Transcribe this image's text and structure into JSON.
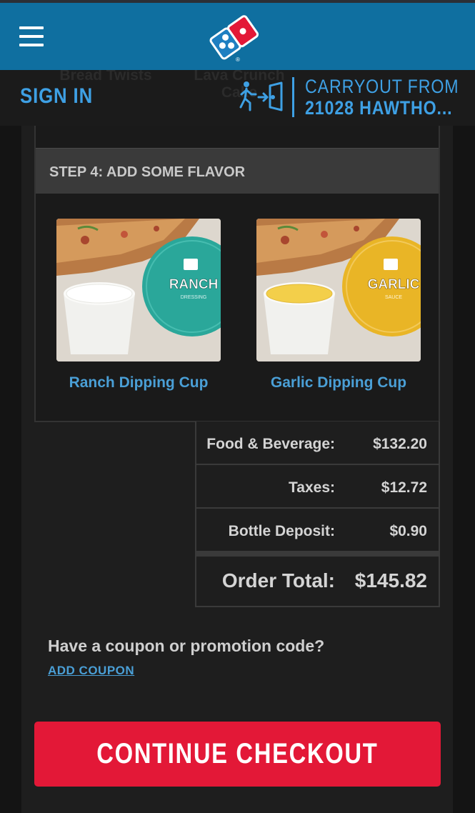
{
  "header": {
    "menu_icon": "hamburger-menu-icon",
    "logo_icon": "dominos-logo-icon",
    "brand_colors": {
      "header_bg": "#0f6fa0",
      "logo_red": "#e31837",
      "logo_blue": "#006491"
    }
  },
  "subbar": {
    "ghost_items": [
      "Bread Twists",
      "Lava Crunch Cake"
    ],
    "sign_in": "SIGN IN",
    "carryout_icon": "walk-into-store-icon",
    "carryout_line1": "CARRYOUT FROM",
    "carryout_line2": "21028 HAWTHO..."
  },
  "flavor": {
    "step_title": "STEP 4: ADD SOME FLAVOR",
    "items": [
      {
        "label": "Ranch Dipping Cup",
        "cup_text": "RANCH",
        "cup_sub": "DRESSING",
        "cup_color": "#2aa79a"
      },
      {
        "label": "Garlic Dipping Cup",
        "cup_text": "GARLIC",
        "cup_sub": "SAUCE",
        "cup_color": "#e9b526"
      }
    ]
  },
  "summary": {
    "food_label": "Food & Beverage:",
    "food_value": "$132.20",
    "taxes_label": "Taxes:",
    "taxes_value": "$12.72",
    "deposit_label": "Bottle Deposit:",
    "deposit_value": "$0.90",
    "total_label": "Order Total:",
    "total_value": "$145.82"
  },
  "coupon": {
    "question": "Have a coupon or promotion code?",
    "link": "ADD COUPON"
  },
  "checkout": {
    "label": "CONTINUE CHECKOUT",
    "color": "#e31837"
  }
}
